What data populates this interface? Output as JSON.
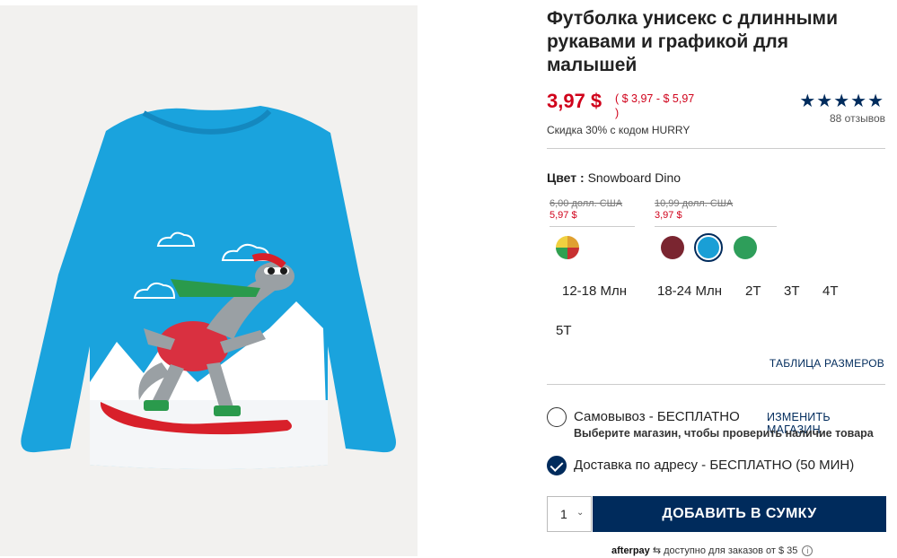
{
  "product": {
    "title": "Футболка унисекс с длинными рукавами и графикой для малышей",
    "price": "3,97 $",
    "price_range": "( $ 3,97 - $ 5,97 )",
    "promo": "Скидка 30% с кодом HURRY",
    "rating_stars": "★★★★★",
    "rating_value": 5,
    "reviews": "88 отзывов"
  },
  "color": {
    "label": "Цвет :",
    "selected": "Snowboard Dino",
    "price_groups": [
      {
        "old": "6,00 долл. США",
        "new": "5,97 $"
      },
      {
        "old": "10,99 долл. США",
        "new": "3,97 $"
      }
    ],
    "swatches": [
      {
        "name": "bus-print",
        "color": "#e0a030"
      },
      {
        "name": "my-family",
        "color": "#7a2530"
      },
      {
        "name": "snowboard-dino",
        "color": "#1a9fd6"
      },
      {
        "name": "elf",
        "color": "#2e9e5a"
      }
    ]
  },
  "sizes": [
    "12-18 Млн",
    "18-24 Млн",
    "2T",
    "3T",
    "4T",
    "5T"
  ],
  "size_chart": "ТАБЛИЦА РАЗМЕРОВ",
  "fulfillment": {
    "pickup_label": "Самовывоз - БЕСПЛАТНО",
    "change_store": "ИЗМЕНИТЬ МАГАЗИН",
    "pickup_note": "Выберите магазин, чтобы проверить наличие товара",
    "delivery_label": "Доставка по адресу - БЕСПЛАТНО (50 МИН)"
  },
  "cart": {
    "quantity": "1",
    "add_button": "ДОБАВИТЬ В СУМКУ"
  },
  "afterpay": {
    "logo": "afterpay",
    "text": "доступно для заказов от $ 35",
    "info": "i"
  },
  "colors": {
    "brand_navy": "#002b5c",
    "sale_red": "#d0021b",
    "shirt_blue": "#1a9fd6"
  }
}
